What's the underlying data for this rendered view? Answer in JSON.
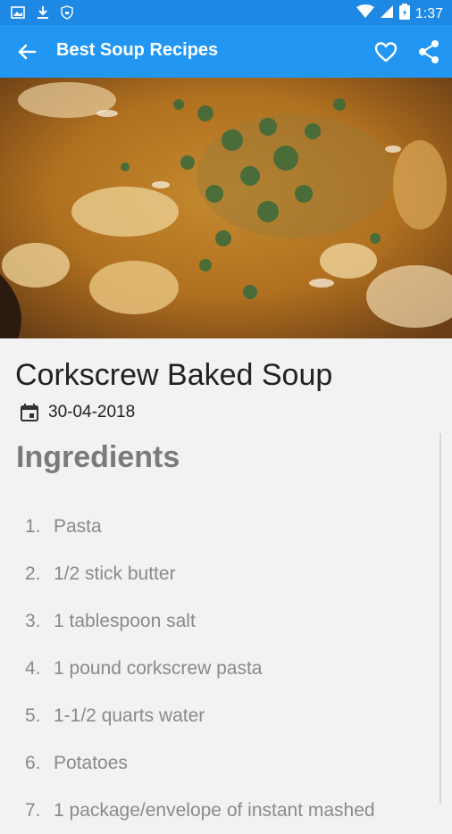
{
  "status_bar": {
    "time": "1:37",
    "icons": [
      "image-icon",
      "download-icon",
      "shield-icon",
      "wifi-icon",
      "signal-icon",
      "battery-icon"
    ]
  },
  "app_bar": {
    "title": "Best Soup Recipes",
    "back_icon": "arrow-back-icon",
    "favorite_icon": "heart-outline-icon",
    "share_icon": "share-icon"
  },
  "recipe": {
    "title": "Corkscrew Baked Soup",
    "date": "30-04-2018",
    "date_icon": "calendar-icon",
    "section_title": "Ingredients",
    "ingredients": [
      {
        "num": "1.",
        "text": "Pasta"
      },
      {
        "num": "2.",
        "text": "1/2 stick butter"
      },
      {
        "num": "3.",
        "text": "1 tablespoon salt"
      },
      {
        "num": "4.",
        "text": "1 pound corkscrew pasta"
      },
      {
        "num": "5.",
        "text": "1-1/2 quarts water"
      },
      {
        "num": "6.",
        "text": "Potatoes"
      },
      {
        "num": "7.",
        "text": "1 package/envelope of instant mashed"
      }
    ]
  },
  "colors": {
    "status_bar": "#1e88e5",
    "app_bar": "#2196f3",
    "background": "#f2f2f2"
  }
}
